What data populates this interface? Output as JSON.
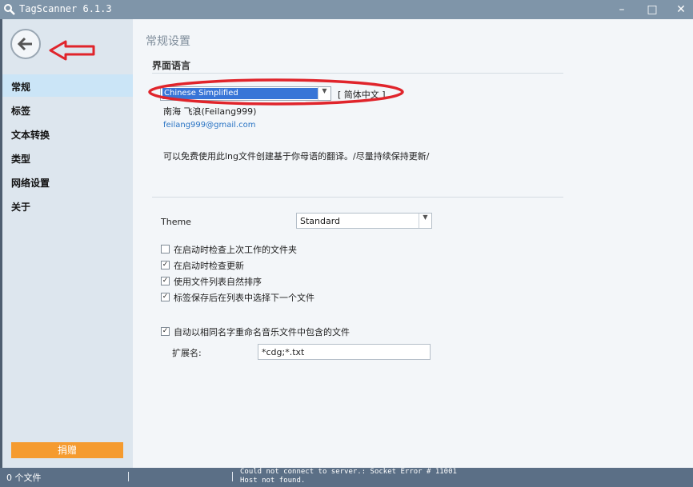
{
  "window": {
    "title": "TagScanner 6.1.3"
  },
  "sidebar": {
    "items": [
      {
        "label": "常规",
        "active": true
      },
      {
        "label": "标签"
      },
      {
        "label": "文本转换"
      },
      {
        "label": "类型"
      },
      {
        "label": "网络设置"
      },
      {
        "label": "关于"
      }
    ],
    "donate_label": "捐赠"
  },
  "main": {
    "page_title": "常规设置",
    "section_title": "界面语言",
    "language": {
      "selected": "Chinese Simplified",
      "native_name": "[ 简体中文 ]",
      "translator": "南海 飞浪(Feilang999)",
      "email": "feilang999@gmail.com",
      "note": "可以免费使用此lng文件创建基于你母语的翻译。/尽量持续保持更新/"
    },
    "theme": {
      "label": "Theme",
      "value": "Standard"
    },
    "options": [
      {
        "label": "在启动时检查上次工作的文件夹",
        "checked": false
      },
      {
        "label": "在启动时检查更新",
        "checked": true
      },
      {
        "label": "使用文件列表自然排序",
        "checked": true
      },
      {
        "label": "标签保存后在列表中选择下一个文件",
        "checked": true
      }
    ],
    "auto_rename": {
      "label": "自动以相同名字重命名音乐文件中包含的文件",
      "checked": true
    },
    "extensions": {
      "label": "扩展名:",
      "value": "*cdg;*.txt"
    }
  },
  "status": {
    "file_count": "0 个文件",
    "message_line1": "Could not connect to server.: Socket Error # 11001",
    "message_line2": "Host not found."
  },
  "colors": {
    "annotation": "#e0242b",
    "accent": "#3875d7",
    "donate": "#f59b2f"
  }
}
